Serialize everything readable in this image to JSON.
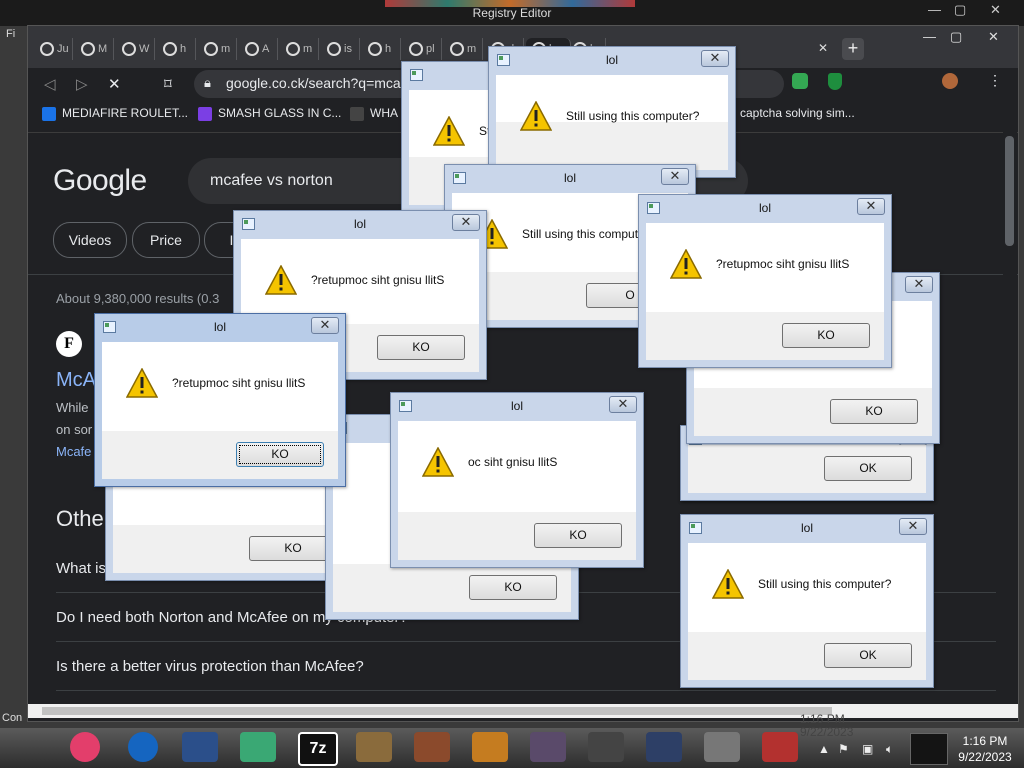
{
  "registry_editor": {
    "title": "Registry Editor",
    "left_menu_fragment": "Fi",
    "left_status_fragment": "Con"
  },
  "colors": {
    "chrome_bg": "#202124",
    "link": "#8ab4f8",
    "dialog_frame": "#c9d6ea",
    "taskbar": "#2d2d2d"
  },
  "browser": {
    "tabs": [
      "Ju",
      "M",
      "W",
      "h",
      "m",
      "A",
      "m",
      "is",
      "h",
      "pl",
      "m",
      "d",
      "h",
      "h"
    ],
    "new_tab_icon": "plus-icon",
    "address": "google.co.ck/search?q=mca",
    "bookmarks": [
      "MEDIAFIRE ROULET...",
      "SMASH GLASS IN C...",
      "WHA",
      "captcha solving sim..."
    ]
  },
  "google": {
    "logo": "Google",
    "query": "mcafee vs norton",
    "chips": [
      "Videos",
      "Price",
      "Imag"
    ],
    "stats": "About 9,380,000 results (0.3",
    "result_favicon": "F",
    "result_title": "McA",
    "snippet_lines": [
      "While",
      "on sor"
    ],
    "snippet_link": "Mcafe",
    "other_heading": "Othe",
    "questions": [
      "What is",
      "Do I need both Norton and McAfee on my computer?",
      "Is there a better virus protection than McAfee?"
    ]
  },
  "dialogs": [
    {
      "title": "",
      "message": "Stil",
      "button": ""
    },
    {
      "title": "lol",
      "message": "Still using this computer?",
      "button": ""
    },
    {
      "title": "lol",
      "message": "Still using this compute",
      "button": "O"
    },
    {
      "title": "lol",
      "message": "?retupmoc siht gnisu llitS",
      "button": "KO"
    },
    {
      "title": "",
      "message": "",
      "button": "KO"
    },
    {
      "title": "lol",
      "message": "?retupmoc siht gnisu llitS",
      "button": "KO"
    },
    {
      "title": "lol",
      "message": "?retupmoc siht gnisu llitS",
      "button": "KO"
    },
    {
      "title": "",
      "message": "",
      "button": "KO"
    },
    {
      "title": "lol",
      "message": "oc siht gnisu llitS",
      "button": "KO"
    },
    {
      "title": "",
      "message": "",
      "button": "OK"
    },
    {
      "title": "",
      "message": "S",
      "button": "KO"
    },
    {
      "title": "",
      "message": "",
      "button": "OK"
    },
    {
      "title": "lol",
      "message": "Still using this computer?",
      "button": "OK"
    }
  ],
  "taskbar": {
    "icons": [
      "onenote-icon",
      "firefox-icon",
      "window-icon",
      "notes-icon",
      "7z-icon",
      "files-icon",
      "book-icon",
      "calculator-icon",
      "chart-icon",
      "app-icon",
      "presentation-icon",
      "robot-icon",
      "cube-icon"
    ],
    "seven_zip_label": "7z",
    "time": "1:16 PM",
    "date": "9/22/2023"
  }
}
